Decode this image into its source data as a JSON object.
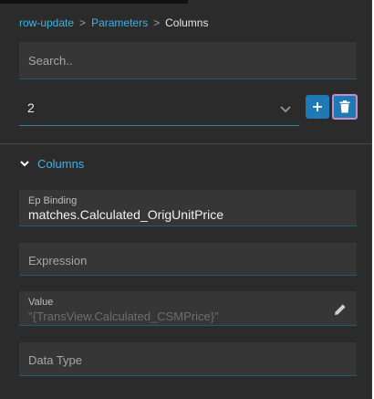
{
  "breadcrumb": {
    "items": [
      {
        "label": "row-update"
      },
      {
        "label": "Parameters"
      }
    ],
    "current": "Columns",
    "separator": ">"
  },
  "search": {
    "placeholder": "Search.."
  },
  "selector": {
    "value": "2"
  },
  "buttons": {
    "add_icon": "plus-icon",
    "delete_icon": "trash-icon"
  },
  "section": {
    "title": "Columns"
  },
  "fields": {
    "ep_binding": {
      "label": "Ep Binding",
      "value": "matches.Calculated_OrigUnitPrice"
    },
    "expression": {
      "placeholder": "Expression"
    },
    "value_field": {
      "label": "Value",
      "value": "\"{TransView.Calculated_CSMPrice}\""
    },
    "data_type": {
      "placeholder": "Data Type"
    }
  },
  "colors": {
    "accent": "#3bb3e6",
    "button": "#1f79b4",
    "panel": "#2b2b2b",
    "field": "#363636"
  }
}
